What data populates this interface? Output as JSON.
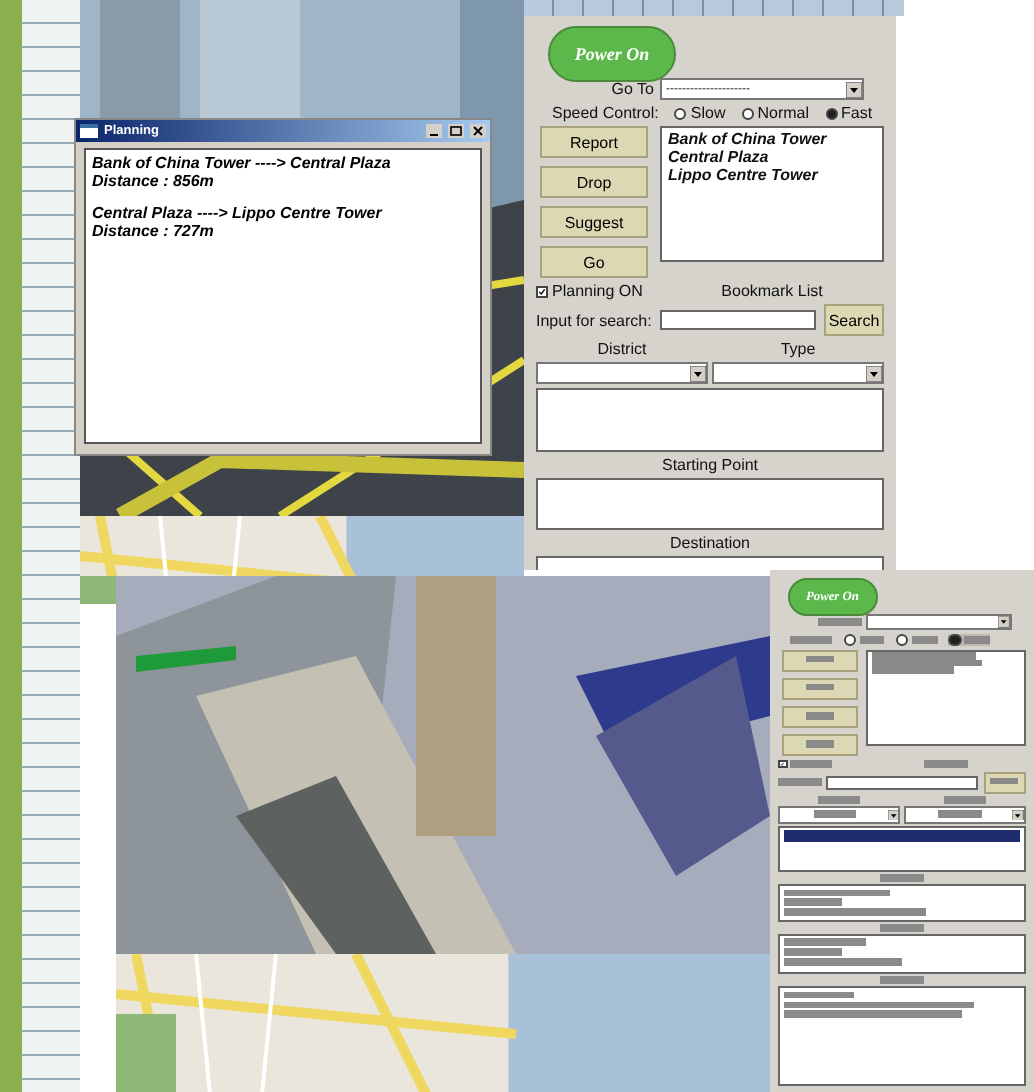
{
  "top_screenshot": {
    "planning_window": {
      "title": "Planning",
      "routes": [
        {
          "path": "Bank of China Tower ----> Central Plaza",
          "distance": "Distance : 856m"
        },
        {
          "path": "Central Plaza ----> Lippo Centre Tower",
          "distance": "Distance : 727m"
        }
      ]
    },
    "panel": {
      "power_button": "Power On",
      "goto_label": "Go To",
      "goto_value": "---------------------",
      "speed_label": "Speed Control:",
      "speed_options": [
        {
          "label": "Slow",
          "selected": false
        },
        {
          "label": "Normal",
          "selected": false
        },
        {
          "label": "Fast",
          "selected": true
        }
      ],
      "buttons": [
        "Report",
        "Drop",
        "Suggest",
        "Go"
      ],
      "bookmarks": [
        "Bank of China Tower",
        "Central Plaza",
        "Lippo Centre Tower"
      ],
      "planning": {
        "label": "Planning ON",
        "checked": true
      },
      "bookmark_label": "Bookmark List",
      "search_label": "Input for search:",
      "search_button": "Search",
      "district_label": "District",
      "type_label": "Type",
      "starting_point_label": "Starting Point",
      "destination_label": "Destination",
      "blurred": false
    }
  },
  "bottom_screenshot": {
    "panel": {
      "power_button": "Power On",
      "speed_options": [
        {
          "selected": false
        },
        {
          "selected": false
        },
        {
          "selected": true
        }
      ],
      "planning": {
        "checked": true
      },
      "blurred": true
    }
  }
}
